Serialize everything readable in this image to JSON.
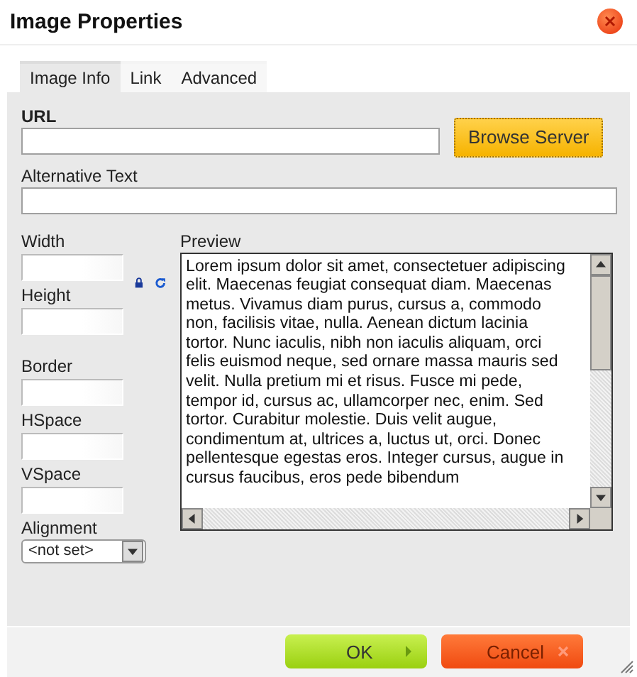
{
  "window": {
    "title": "Image Properties"
  },
  "tabs": [
    {
      "label": "Image Info",
      "selected": true
    },
    {
      "label": "Link",
      "selected": false
    },
    {
      "label": "Advanced",
      "selected": false
    }
  ],
  "url": {
    "label": "URL"
  },
  "browse_button": "Browse Server",
  "alt_text": {
    "label": "Alternative Text"
  },
  "dimension_fields": [
    {
      "label": "Width"
    },
    {
      "label": "Height"
    }
  ],
  "spacing_fields": [
    {
      "label": "Border"
    },
    {
      "label": "HSpace"
    },
    {
      "label": "VSpace"
    }
  ],
  "alignment": {
    "label": "Alignment",
    "value": "<not set>"
  },
  "preview": {
    "label": "Preview",
    "text": "Lorem ipsum dolor sit amet, consectetuer adipiscing elit. Maecenas feugiat consequat diam. Maecenas metus. Vivamus diam purus, cursus a, commodo non, facilisis vitae, nulla. Aenean dictum lacinia tortor. Nunc iaculis, nibh non iaculis aliquam, orci felis euismod neque, sed ornare massa mauris sed velit. Nulla pretium mi et risus. Fusce mi pede, tempor id, cursus ac, ullamcorper nec, enim. Sed tortor. Curabitur molestie. Duis velit augue, condimentum at, ultrices a, luctus ut, orci. Donec pellentesque egestas eros. Integer cursus, augue in cursus faucibus, eros pede bibendum"
  },
  "buttons": [
    {
      "label": "OK",
      "kind": "ok"
    },
    {
      "label": "Cancel",
      "kind": "cancel"
    }
  ]
}
